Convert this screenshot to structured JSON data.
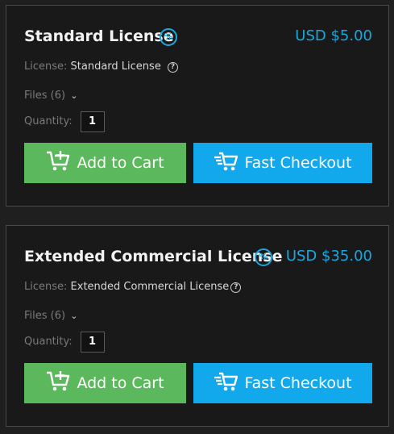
{
  "colors": {
    "accent": "#1aa7e0",
    "add_to_cart": "#5cb85c",
    "fast_checkout": "#12a9ec",
    "panel_bg": "#191919"
  },
  "licenses": [
    {
      "title": "Standard License",
      "discount_icon": "percent-circle-icon",
      "price": "USD $5.00",
      "license_label": "License:",
      "license_value": "Standard License",
      "help_icon": "?",
      "files_label": "Files (6)",
      "quantity_label": "Quantity:",
      "quantity_value": "1",
      "add_to_cart_label": "Add to Cart",
      "fast_checkout_label": "Fast Checkout"
    },
    {
      "title": "Extended Commercial License",
      "discount_icon": "percent-circle-icon",
      "price": "USD $35.00",
      "license_label": "License:",
      "license_value": "Extended Commercial License",
      "help_icon": "?",
      "files_label": "Files (6)",
      "quantity_label": "Quantity:",
      "quantity_value": "1",
      "add_to_cart_label": "Add to Cart",
      "fast_checkout_label": "Fast Checkout"
    }
  ]
}
